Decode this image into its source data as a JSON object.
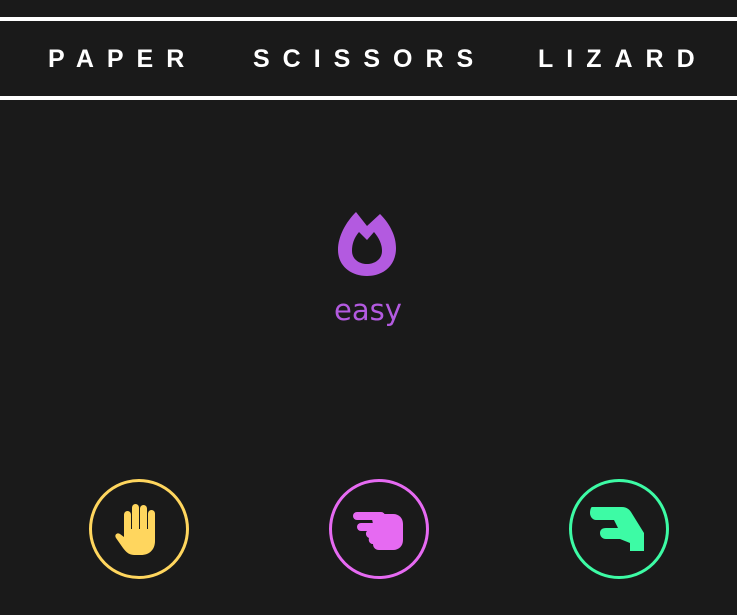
{
  "header": {
    "words": [
      "PAPER",
      "SCISSORS",
      "LIZARD"
    ]
  },
  "difficulty": {
    "label": "easy",
    "icon": "flame-icon",
    "color": "#b35ae0"
  },
  "choices": [
    {
      "name": "paper",
      "icon": "hand-paper-icon",
      "color": "#ffd65e"
    },
    {
      "name": "scissors",
      "icon": "hand-scissors-icon",
      "color": "#e66af2"
    },
    {
      "name": "lizard",
      "icon": "hand-lizard-icon",
      "color": "#3dfba5"
    }
  ],
  "theme": {
    "background": "#1a1a1a",
    "rule": "#ffffff"
  }
}
